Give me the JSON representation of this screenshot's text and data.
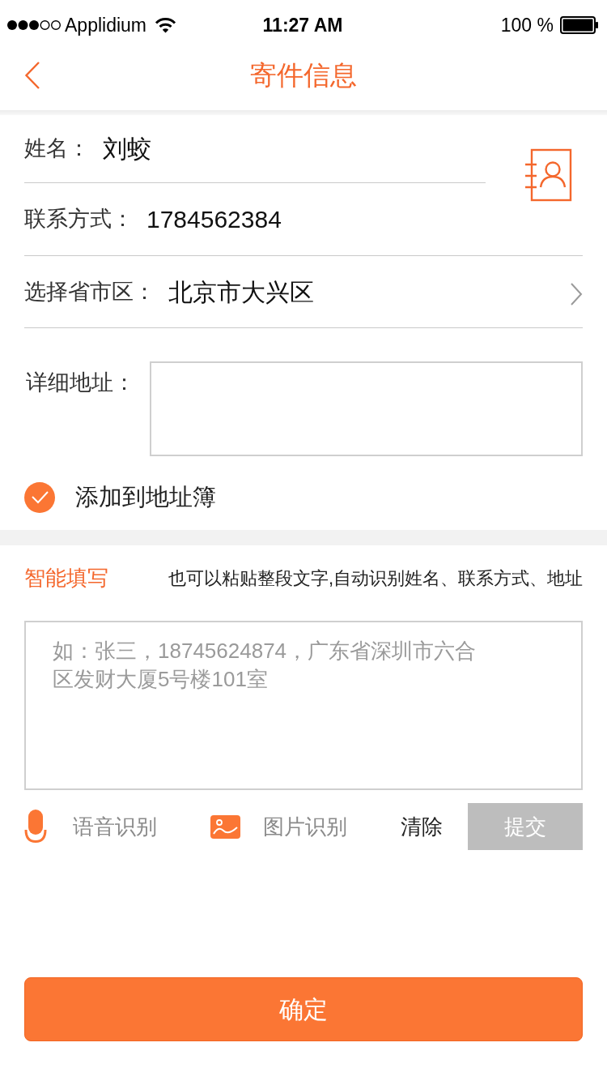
{
  "status_bar": {
    "carrier": "Applidium",
    "time": "11:27 AM",
    "battery": "100 %"
  },
  "header": {
    "title": "寄件信息"
  },
  "sender": {
    "name": {
      "label": "姓名：",
      "value": "刘蛟"
    },
    "phone": {
      "label": "联系方式：",
      "value": "1784562384"
    },
    "region": {
      "label": "选择省市区：",
      "value": "北京市大兴区"
    },
    "address": {
      "label": "详细地址："
    },
    "save_to_address_book": {
      "label": "添加到地址簿",
      "checked": true
    }
  },
  "smart_fill": {
    "title": "智能填写",
    "hint": "也可以粘贴整段文字,自动识别姓名、联系方式、地址",
    "input": {
      "placeholder": "如：张三，18745624874，广东省深圳市六合区发财大厦5号楼101室"
    },
    "tools": [
      {
        "kind": "voice",
        "label": "语音识别"
      },
      {
        "kind": "image",
        "label": "图片识别"
      }
    ],
    "clear_button": {
      "label": "清除"
    },
    "submit_button": {
      "label": "提交",
      "disabled": true
    }
  },
  "confirm_button": {
    "label": "确定"
  }
}
